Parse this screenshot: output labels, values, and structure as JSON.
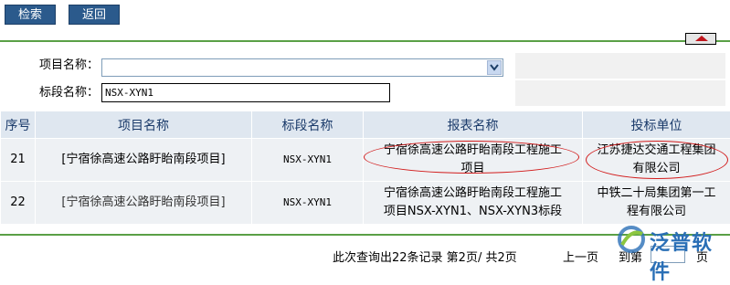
{
  "toolbar": {
    "search_label": "检索",
    "back_label": "返回"
  },
  "form": {
    "project_name_label": "项目名称：",
    "project_name_value": "",
    "section_name_label": "标段名称：",
    "section_name_value": "NSX-XYN1"
  },
  "table": {
    "headers": [
      "序号",
      "项目名称",
      "标段名称",
      "报表名称",
      "投标单位"
    ],
    "rows": [
      {
        "index": "21",
        "project": "[宁宿徐高速公路盱眙南段项目]",
        "section": "NSX-XYN1",
        "report_line1": "宁宿徐高速公路盱眙南段工程施工",
        "report_line2": "项目",
        "bidder_line1": "江苏捷达交通工程集团",
        "bidder_line2": "有限公司"
      },
      {
        "index": "22",
        "project": "[宁宿徐高速公路盱眙南段项目]",
        "section": "NSX-XYN1",
        "report_line1": "宁宿徐高速公路盱眙南段工程施工",
        "report_line2": "项目NSX-XYN1、NSX-XYN3标段",
        "bidder_line1": "中铁二十局集团第一工",
        "bidder_line2": "程有限公司"
      }
    ]
  },
  "pager": {
    "summary": "此次查询出22条记录 第2页/ 共2页",
    "prev": "上一页",
    "goto": "到第",
    "page_suffix": "页",
    "page_input": ""
  },
  "logo": {
    "text": "泛普软件",
    "color": "#2a6fb6"
  },
  "colors": {
    "button": "#2b5a8c",
    "rule": "#5aa046",
    "header_bg": "#dfe7f0",
    "annotation": "#d21c1c"
  }
}
